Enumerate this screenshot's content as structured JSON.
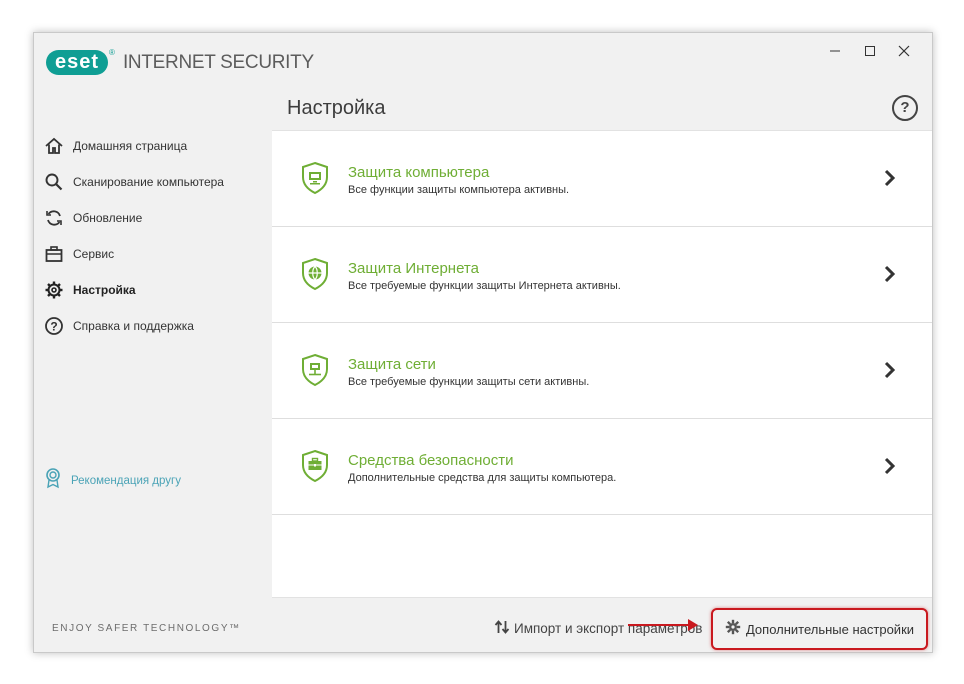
{
  "app": {
    "logo_mark": "eset",
    "logo_reg": "®",
    "product_name": "INTERNET SECURITY",
    "tagline": "ENJOY SAFER TECHNOLOGY™"
  },
  "window_controls": {
    "minimize": "minimize-icon",
    "maximize": "maximize-icon",
    "close": "close-icon"
  },
  "sidebar": {
    "items": [
      {
        "label": "Домашняя страница",
        "icon": "home-icon",
        "active": false
      },
      {
        "label": "Сканирование компьютера",
        "icon": "search-icon",
        "active": false
      },
      {
        "label": "Обновление",
        "icon": "refresh-icon",
        "active": false
      },
      {
        "label": "Сервис",
        "icon": "briefcase-icon",
        "active": false
      },
      {
        "label": "Настройка",
        "icon": "gear-icon",
        "active": true
      },
      {
        "label": "Справка и поддержка",
        "icon": "help-icon",
        "active": false
      }
    ],
    "recommend": {
      "label": "Рекомендация другу",
      "icon": "badge-icon"
    }
  },
  "main": {
    "title": "Настройка",
    "help": "?",
    "cards": [
      {
        "title": "Защита компьютера",
        "desc": "Все функции защиты компьютера активны.",
        "icon": "shield-monitor-icon"
      },
      {
        "title": "Защита Интернета",
        "desc": "Все требуемые функции защиты Интернета активны.",
        "icon": "shield-globe-icon"
      },
      {
        "title": "Защита сети",
        "desc": "Все требуемые функции защиты сети активны.",
        "icon": "shield-network-icon"
      },
      {
        "title": "Средства безопасности",
        "desc": "Дополнительные средства для защиты компьютера.",
        "icon": "shield-toolbox-icon"
      }
    ]
  },
  "footer": {
    "import_label": "Импорт и экспорт параметров",
    "advanced_label": "Дополнительные настройки"
  },
  "colors": {
    "accent_green": "#6fae35",
    "brand_teal": "#0f9e94",
    "highlight_red": "#c9191f"
  }
}
